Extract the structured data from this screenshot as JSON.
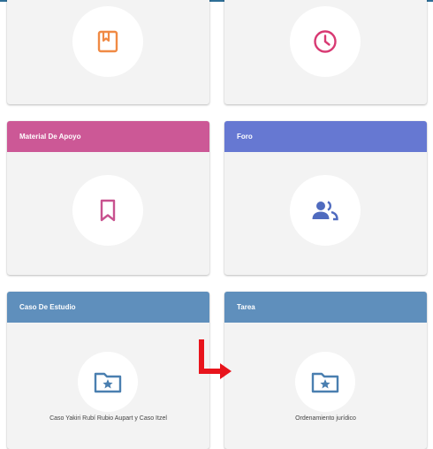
{
  "cards": [
    {
      "id": "top-left",
      "header": "",
      "icon": "book-icon",
      "caption": "",
      "color": ""
    },
    {
      "id": "top-right",
      "header": "",
      "icon": "clock-icon",
      "caption": "",
      "color": ""
    },
    {
      "id": "material",
      "header": "Material De Apoyo",
      "icon": "bookmark-icon",
      "caption": "",
      "color": "#cc5896"
    },
    {
      "id": "foro",
      "header": "Foro",
      "icon": "people-icon",
      "caption": "",
      "color": "#6678d2"
    },
    {
      "id": "caso",
      "header": "Caso De Estudio",
      "icon": "folder-star-icon",
      "caption": "Caso Yakiri Rubí Rubio Aupart y Caso Itzel",
      "color": "#5f8fbc"
    },
    {
      "id": "tarea",
      "header": "Tarea",
      "icon": "folder-star-icon",
      "caption": "Ordenamiento jurídico",
      "color": "#5f8fbc"
    }
  ],
  "annotation": {
    "icon": "red-arrow-icon",
    "color": "#e8141c"
  }
}
